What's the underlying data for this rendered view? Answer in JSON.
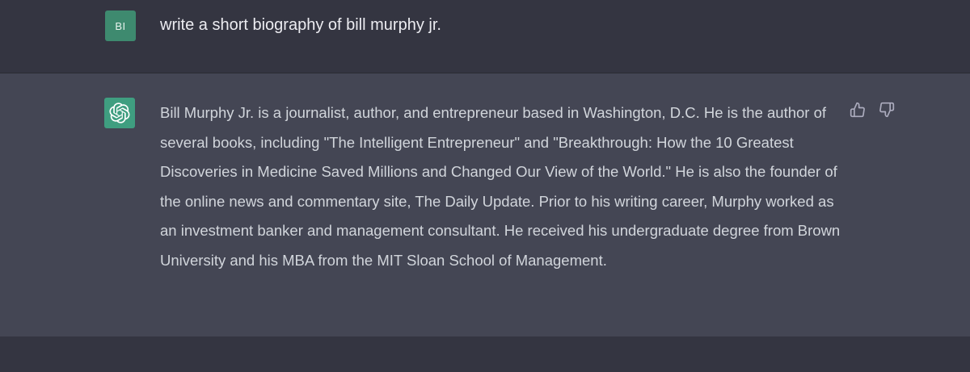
{
  "user_message": {
    "avatar_initials": "BI",
    "text": "write a short biography of bill murphy jr."
  },
  "assistant_message": {
    "avatar_icon": "openai-logo-icon",
    "text": "Bill Murphy Jr. is a journalist, author, and entrepreneur based in Washington, D.C. He is the author of several books, including \"The Intelligent Entrepreneur\" and \"Breakthrough: How the 10 Greatest Discoveries in Medicine Saved Millions and Changed Our View of the World.\" He is also the founder of the online news and commentary site, The Daily Update. Prior to his writing career, Murphy worked as an investment banker and management consultant. He received his undergraduate degree from Brown University and his MBA from the MIT Sloan School of Management."
  },
  "feedback": {
    "thumbs_up_icon": "thumbs-up-icon",
    "thumbs_down_icon": "thumbs-down-icon"
  },
  "colors": {
    "page_background": "#343541",
    "assistant_background": "#444654",
    "avatar_green": "#3f9e80",
    "text_primary": "#ececf1",
    "text_secondary": "#d1d5db",
    "icon_gray": "#acacbe"
  }
}
